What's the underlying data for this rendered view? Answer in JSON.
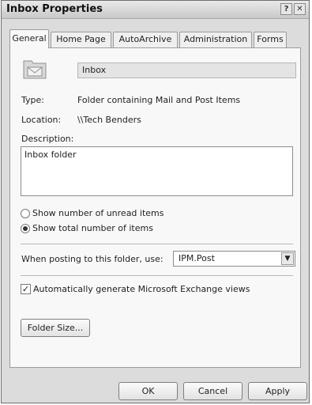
{
  "window": {
    "title": "Inbox Properties",
    "help_glyph": "?",
    "close_glyph": "✕"
  },
  "tabs": [
    {
      "label": "General",
      "active": true
    },
    {
      "label": "Home Page",
      "active": false
    },
    {
      "label": "AutoArchive",
      "active": false
    },
    {
      "label": "Administration",
      "active": false
    },
    {
      "label": "Forms",
      "active": false
    }
  ],
  "general": {
    "folder_icon": "mail-folder-icon",
    "folder_name": "Inbox",
    "type_label": "Type:",
    "type_value": "Folder containing Mail and Post Items",
    "location_label": "Location:",
    "location_value": "\\\\Tech Benders",
    "description_label": "Description:",
    "description_value": "Inbox folder",
    "radio_unread_label": "Show number of unread items",
    "radio_total_label": "Show total number of items",
    "radio_selected": "total",
    "posting_label": "When posting to this folder, use:",
    "posting_value": "IPM.Post",
    "auto_views_label": "Automatically generate Microsoft Exchange views",
    "auto_views_checked": true,
    "folder_size_button": "Folder Size..."
  },
  "buttons": {
    "ok": "OK",
    "cancel": "Cancel",
    "apply": "Apply"
  }
}
